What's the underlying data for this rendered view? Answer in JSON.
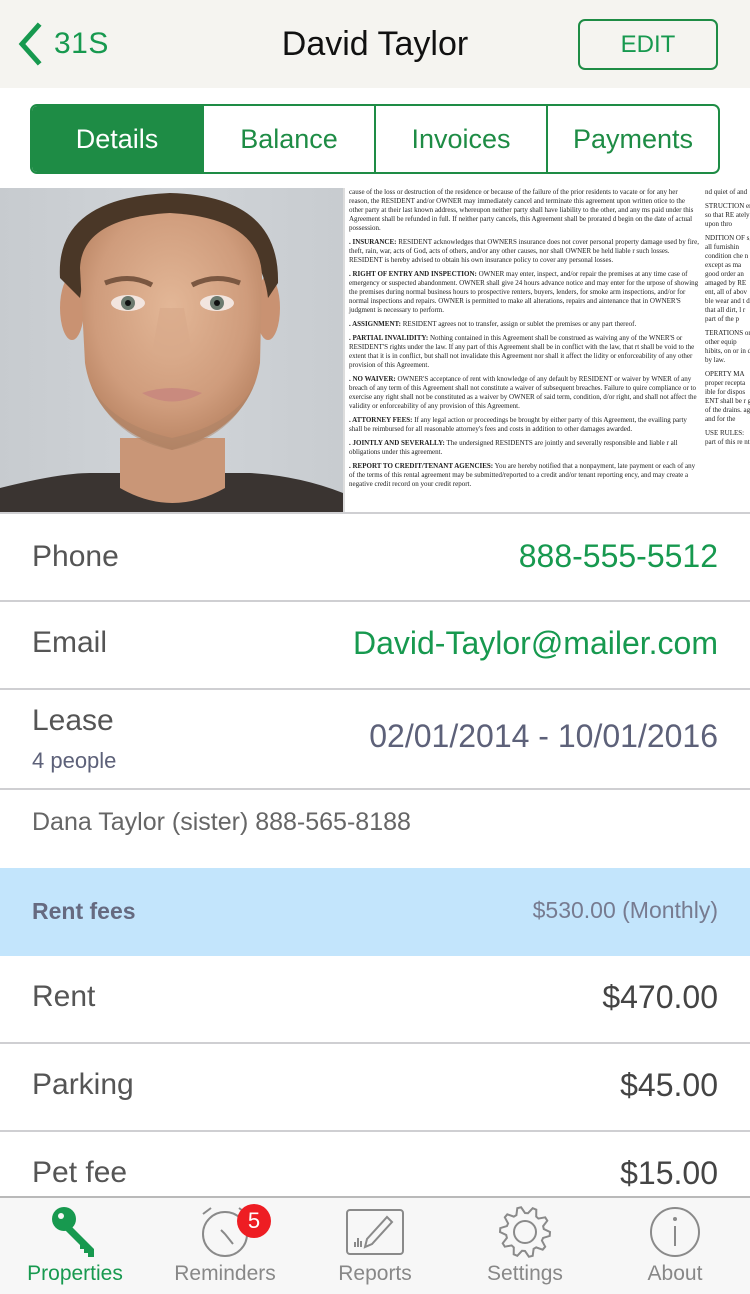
{
  "nav": {
    "back_label": "31S",
    "title": "David Taylor",
    "edit_label": "EDIT"
  },
  "tabs": [
    {
      "label": "Details",
      "active": true
    },
    {
      "label": "Balance",
      "active": false
    },
    {
      "label": "Invoices",
      "active": false
    },
    {
      "label": "Payments",
      "active": false
    }
  ],
  "document_preview": {
    "main_column": [
      {
        "heading": "",
        "text": "cause of the loss or destruction of the residence or because of the failure of the prior residents to vacate or for any her reason, the RESIDENT and/or OWNER may immediately cancel and terminate this agreement upon written otice to the other party at their last known address, whereupon neither party shall have liability to the other, and any ms paid under this Agreement shall be refunded in full. If neither party cancels, this Agreement shall be prorated d begin on the date of actual possession."
      },
      {
        "heading": ". INSURANCE:",
        "text": "RESIDENT acknowledges that OWNERS insurance does not cover personal property damage used by fire, theft, rain, war, acts of God, acts of others, and/or any other causes, nor shall OWNER be held liable r such losses. RESIDENT is hereby advised to obtain his own insurance policy to cover any personal losses."
      },
      {
        "heading": ". RIGHT OF ENTRY AND INSPECTION:",
        "text": "OWNER may enter, inspect, and/or repair the premises at any time case of emergency or suspected abandonment. OWNER shall give 24 hours advance notice and may enter for the urpose of showing the premises during normal business hours to prospective renters, buyers, lenders, for smoke arm inspections, and/or for normal inspections and repairs. OWNER is permitted to make all alterations, repairs and aintenance that in OWNER'S judgment is necessary to perform."
      },
      {
        "heading": ". ASSIGNMENT:",
        "text": "RESIDENT agrees not to transfer, assign or sublet the premises or any part thereof."
      },
      {
        "heading": ". PARTIAL INVALIDITY:",
        "text": "Nothing contained in this Agreement shall be construed as waiving any of the WNER'S or RESIDENT'S rights under the law. If any part of this Agreement shall be in conflict with the law, that rt shall be void to the extent that it is in conflict, but shall not invalidate this Agreement nor shall it affect the lidity or enforceability of any other provision of this Agreement."
      },
      {
        "heading": ". NO WAIVER:",
        "text": "OWNER'S acceptance of rent with knowledge of any default by RESIDENT or waiver by WNER of any breach of any term of this Agreement shall not constitute a waiver of subsequent breaches. Failure to quire compliance or to exercise any right shall not be constituted as a waiver by OWNER of said term, condition, d/or right, and shall not affect the validity or enforceability of any provision of this Agreement."
      },
      {
        "heading": ". ATTORNEY FEES:",
        "text": "If any legal action or proceedings be brought by either party of this Agreement, the evailing party shall be reimbursed for all reasonable attorney's fees and costs in addition to other damages awarded."
      },
      {
        "heading": ". JOINTLY AND SEVERALLY:",
        "text": "The undersigned RESIDENTS are jointly and severally responsible and liable r all obligations under this agreement."
      },
      {
        "heading": ". REPORT TO CREDIT/TENANT AGENCIES:",
        "text": "You are hereby notified that a nonpayment, late payment or each of any of the terms of this rental agreement may be submitted/reported to a credit and/or tenant reporting ency, and may create a negative credit record on your credit report."
      }
    ],
    "side_column": [
      "nd quiet of and",
      "STRUCTION ent so that RE ately upon thro",
      "NDITION OF s, all furnishin condition che n except as ma good order an amaged by RE ent, all of abov ble wear and t d that all dirt, l r part of the p",
      "TERATIONS or other equip hibits, on or in d by law.",
      "OPERTY MA proper recepta ible for dispos ENT shall be r g of the drains. age and for the",
      "USE RULES: part of this re nt."
    ]
  },
  "details": {
    "phone": {
      "label": "Phone",
      "value": "888-555-5512"
    },
    "email": {
      "label": "Email",
      "value": "David-Taylor@mailer.com"
    },
    "lease": {
      "label": "Lease",
      "sublabel": "4 people",
      "value": "02/01/2014 - 10/01/2016"
    },
    "contact": "Dana Taylor (sister) 888-565-8188"
  },
  "fees": {
    "header_label": "Rent fees",
    "header_value": "$530.00 (Monthly)",
    "items": [
      {
        "label": "Rent",
        "value": "$470.00"
      },
      {
        "label": "Parking",
        "value": "$45.00"
      },
      {
        "label": "Pet fee",
        "value": "$15.00"
      }
    ]
  },
  "tabbar": {
    "items": [
      {
        "label": "Properties",
        "icon": "key-icon",
        "active": true
      },
      {
        "label": "Reminders",
        "icon": "alarm-clock-icon",
        "badge": "5"
      },
      {
        "label": "Reports",
        "icon": "report-pencil-icon"
      },
      {
        "label": "Settings",
        "icon": "gear-icon"
      },
      {
        "label": "About",
        "icon": "info-icon"
      }
    ]
  },
  "colors": {
    "accent_green": "#1e8c45",
    "link_green": "#17994f",
    "fees_header_bg": "#c3e5fc",
    "badge_red": "#ee1d23",
    "value_slate": "#5d6179"
  }
}
